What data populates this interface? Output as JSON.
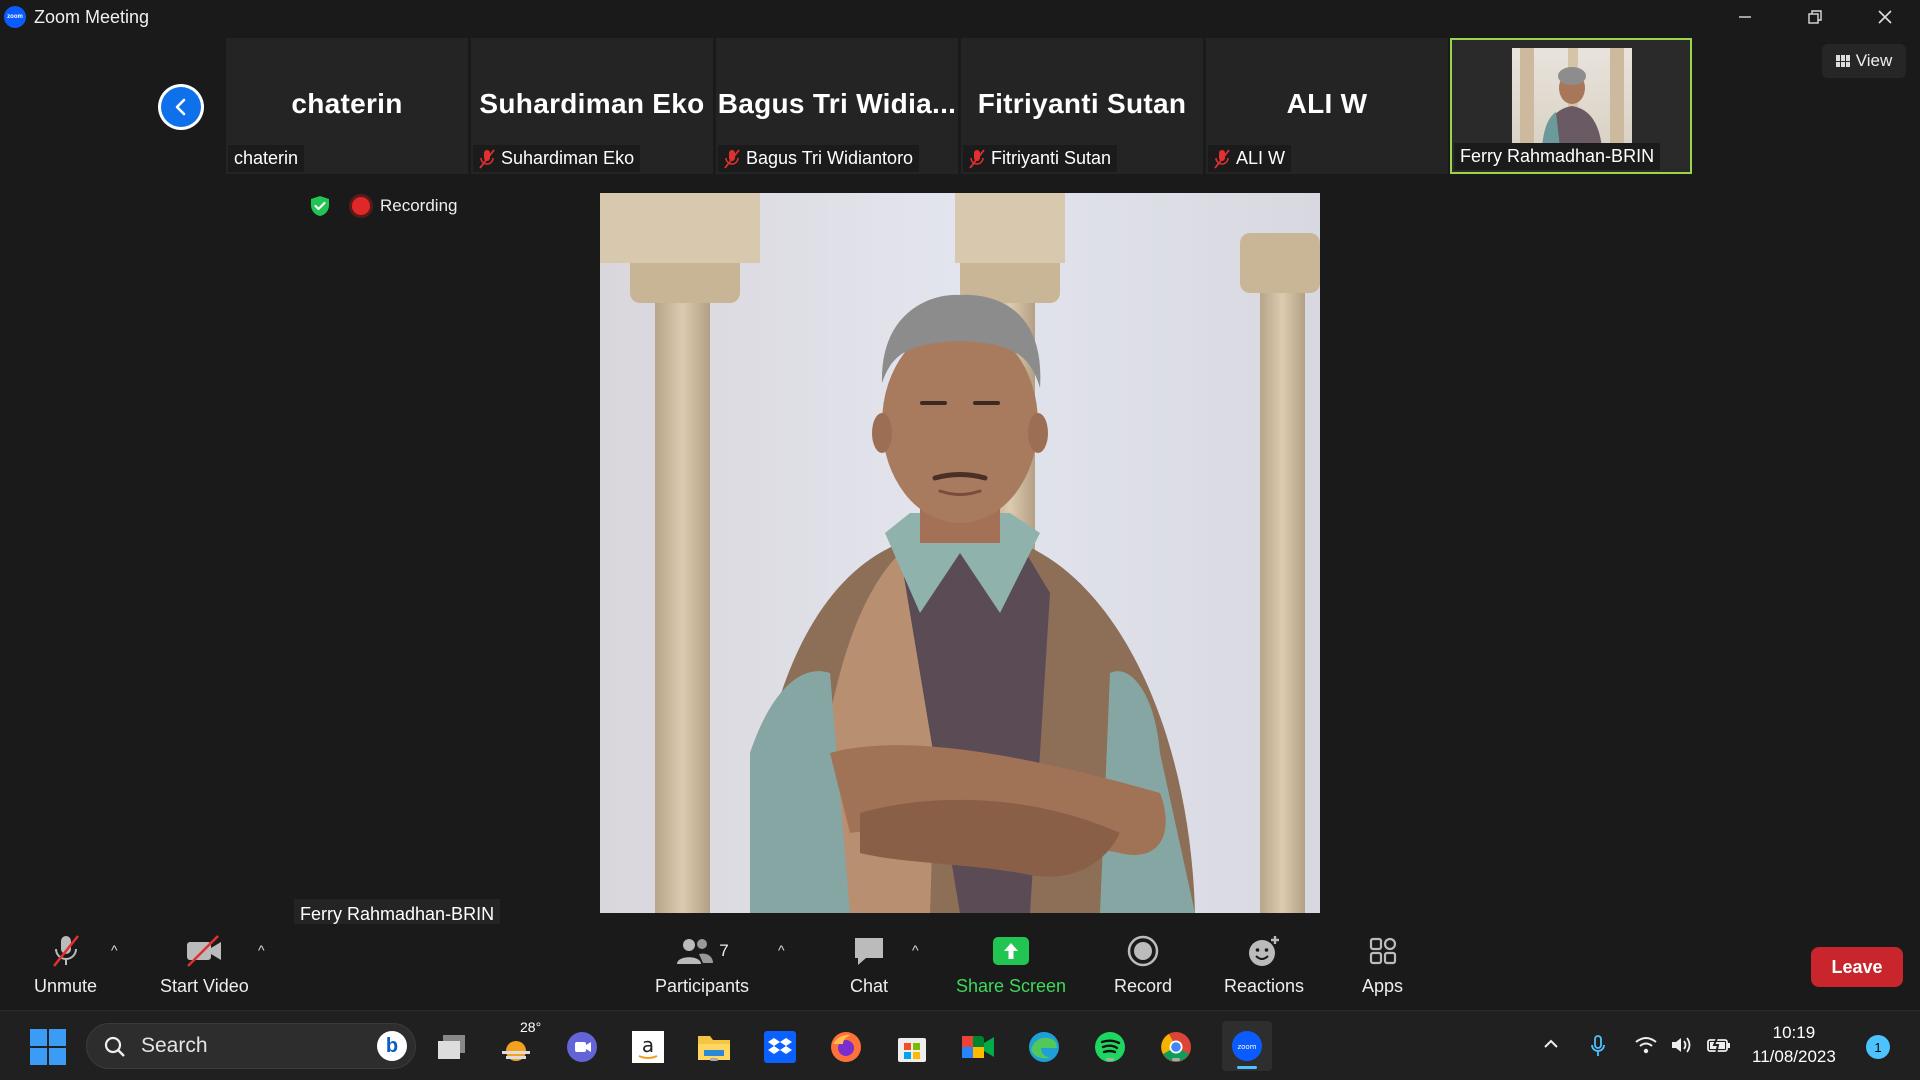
{
  "window": {
    "title": "Zoom Meeting",
    "app_icon": "zoom"
  },
  "view_button": {
    "label": "View"
  },
  "participants_strip": [
    {
      "big_name": "chaterin",
      "label": "chaterin",
      "muted": false
    },
    {
      "big_name": "Suhardiman Eko",
      "label": "Suhardiman Eko",
      "muted": true
    },
    {
      "big_name": "Bagus Tri Widia...",
      "label": "Bagus Tri Widiantoro",
      "muted": true
    },
    {
      "big_name": "Fitriyanti Sutan",
      "label": "Fitriyanti Sutan",
      "muted": true
    },
    {
      "big_name": "ALI W",
      "label": "ALI W",
      "muted": true
    },
    {
      "big_name": "",
      "label": "Ferry Rahmadhan-BRIN",
      "muted": false,
      "active_speaker": true
    }
  ],
  "status": {
    "recording_label": "Recording"
  },
  "main_video": {
    "name_label": "Ferry Rahmadhan-BRIN"
  },
  "toolbar": {
    "unmute": "Unmute",
    "start_video": "Start Video",
    "participants": "Participants",
    "participants_count": "7",
    "chat": "Chat",
    "share_screen": "Share Screen",
    "record": "Record",
    "reactions": "Reactions",
    "apps": "Apps",
    "leave": "Leave"
  },
  "taskbar": {
    "search_label": "Search",
    "weather_temp": "28°",
    "time": "10:19",
    "date": "11/08/2023",
    "notification_count": "1"
  },
  "colors": {
    "accent_blue": "#0e71eb",
    "active_border": "#9bd54b",
    "share_green": "#3dd85c",
    "leave_red": "#c8262c",
    "record_red": "#e02828"
  }
}
